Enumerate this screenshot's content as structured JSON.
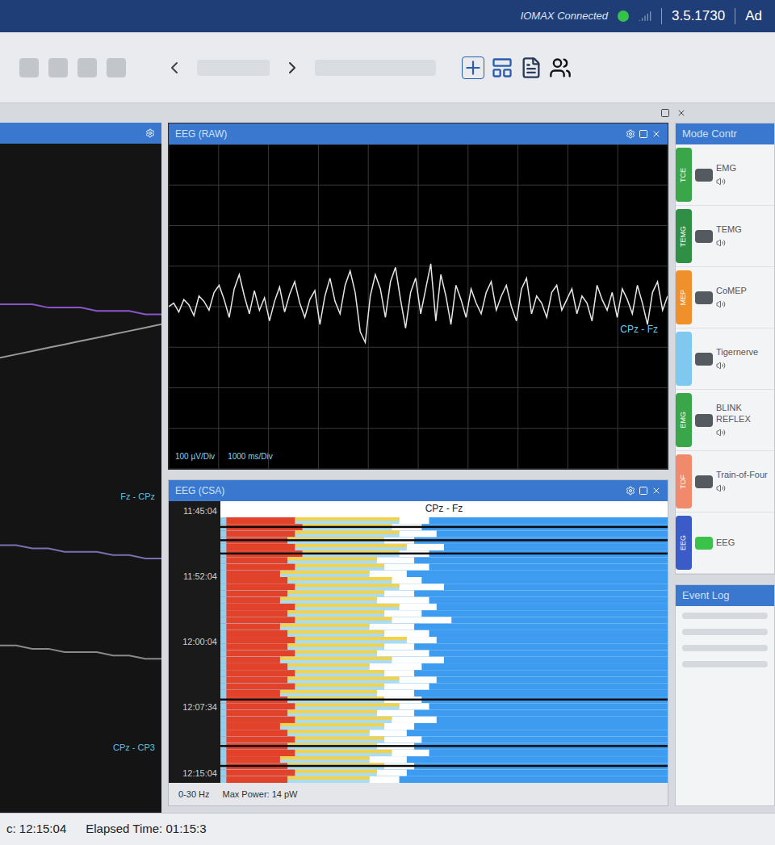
{
  "top_bar": {
    "connection": "IOMAX Connected",
    "connected": true,
    "version": "3.5.1730",
    "user": "Ad"
  },
  "trend_panel": {
    "labels": [
      {
        "text": "Fz - CPz",
        "y": 46
      },
      {
        "text": "CPz - CP3",
        "y": 88
      }
    ],
    "series": [
      {
        "color": "#8a55c9",
        "values": [
          24,
          24,
          24,
          24.5,
          24.5,
          24.5,
          25,
          25,
          25,
          25.5,
          25.5
        ]
      },
      {
        "color": "#9a9a9a",
        "values": [
          32,
          31.5,
          31,
          30.5,
          30,
          29.5,
          29,
          28.5,
          28,
          27.5,
          27
        ]
      },
      {
        "color": "#7a6fb0",
        "values": [
          60,
          60,
          60.5,
          60.5,
          61,
          61,
          61,
          61.5,
          61.5,
          62,
          62
        ]
      },
      {
        "color": "#8a8a8a",
        "values": [
          75,
          75,
          75.5,
          75.5,
          76,
          76,
          76,
          76.5,
          76.5,
          77,
          77
        ]
      }
    ]
  },
  "raw_panel": {
    "title": "EEG (RAW)",
    "channel": "CPz - Fz",
    "scale": [
      "100 µV/Div",
      "1000 ms/Div"
    ],
    "values": [
      0,
      2,
      -3,
      4,
      1,
      -5,
      6,
      3,
      -2,
      8,
      12,
      4,
      -6,
      10,
      18,
      6,
      -4,
      9,
      -2,
      5,
      -8,
      3,
      11,
      -3,
      7,
      14,
      2,
      -6,
      4,
      9,
      -10,
      6,
      16,
      3,
      -4,
      12,
      20,
      8,
      -14,
      -20,
      6,
      18,
      10,
      -6,
      14,
      22,
      4,
      -12,
      8,
      16,
      -4,
      10,
      24,
      -8,
      18,
      6,
      -10,
      12,
      4,
      -6,
      10,
      2,
      -4,
      8,
      14,
      -2,
      6,
      12,
      0,
      -8,
      10,
      16,
      -4,
      6,
      2,
      -6,
      8,
      12,
      -2,
      4,
      10,
      -4,
      6,
      2,
      -8,
      12,
      4,
      -2,
      8,
      -6,
      10,
      4,
      -4,
      12,
      2,
      -10,
      8,
      14,
      -2,
      6
    ]
  },
  "csa_panel": {
    "title": "EEG (CSA)",
    "channel": "CPz - Fz",
    "times": [
      "11:45:04",
      "11:52:04",
      "12:00:04",
      "12:07:34",
      "12:15:04"
    ],
    "range": "0-30 Hz",
    "max_power": "Max Power: 14 pW",
    "rows": [
      {
        "red": 5,
        "yellow": 12,
        "edge": 14,
        "marker": false
      },
      {
        "red": 5.5,
        "yellow": 11.5,
        "edge": 13.5,
        "marker": true
      },
      {
        "red": 5,
        "yellow": 12,
        "edge": 14.5,
        "marker": false
      },
      {
        "red": 4.5,
        "yellow": 11,
        "edge": 13,
        "marker": true
      },
      {
        "red": 5,
        "yellow": 12.5,
        "edge": 15,
        "marker": false
      },
      {
        "red": 5.5,
        "yellow": 12,
        "edge": 14,
        "marker": true
      },
      {
        "red": 4.5,
        "yellow": 10.5,
        "edge": 13,
        "marker": false
      },
      {
        "red": 5,
        "yellow": 11,
        "edge": 14,
        "marker": false
      },
      {
        "red": 4,
        "yellow": 10,
        "edge": 12.5,
        "marker": false
      },
      {
        "red": 4.5,
        "yellow": 11.5,
        "edge": 13.5,
        "marker": false
      },
      {
        "red": 5,
        "yellow": 12,
        "edge": 15,
        "marker": false
      },
      {
        "red": 4.5,
        "yellow": 11,
        "edge": 13,
        "marker": false
      },
      {
        "red": 4,
        "yellow": 10.5,
        "edge": 14,
        "marker": false
      },
      {
        "red": 5,
        "yellow": 12,
        "edge": 14.5,
        "marker": false
      },
      {
        "red": 4.5,
        "yellow": 11,
        "edge": 13.5,
        "marker": false
      },
      {
        "red": 5,
        "yellow": 11.5,
        "edge": 15.5,
        "marker": false
      },
      {
        "red": 4,
        "yellow": 10,
        "edge": 13,
        "marker": false
      },
      {
        "red": 4.5,
        "yellow": 11,
        "edge": 14,
        "marker": false
      },
      {
        "red": 5,
        "yellow": 12.5,
        "edge": 14.5,
        "marker": false
      },
      {
        "red": 4.5,
        "yellow": 11,
        "edge": 13,
        "marker": false
      },
      {
        "red": 5,
        "yellow": 10.5,
        "edge": 14,
        "marker": false
      },
      {
        "red": 4,
        "yellow": 11.5,
        "edge": 15,
        "marker": false
      },
      {
        "red": 4.5,
        "yellow": 10,
        "edge": 13.5,
        "marker": false
      },
      {
        "red": 5,
        "yellow": 11,
        "edge": 13,
        "marker": false
      },
      {
        "red": 4.5,
        "yellow": 12,
        "edge": 14.5,
        "marker": false
      },
      {
        "red": 5,
        "yellow": 11,
        "edge": 14,
        "marker": false
      },
      {
        "red": 4,
        "yellow": 10.5,
        "edge": 13,
        "marker": false
      },
      {
        "red": 4.5,
        "yellow": 11,
        "edge": 13.5,
        "marker": true
      },
      {
        "red": 5,
        "yellow": 12,
        "edge": 14,
        "marker": false
      },
      {
        "red": 4.5,
        "yellow": 10.5,
        "edge": 13,
        "marker": false
      },
      {
        "red": 5,
        "yellow": 11.5,
        "edge": 14.5,
        "marker": false
      },
      {
        "red": 4,
        "yellow": 11,
        "edge": 13,
        "marker": false
      },
      {
        "red": 4.5,
        "yellow": 10,
        "edge": 12.5,
        "marker": false
      },
      {
        "red": 5,
        "yellow": 11,
        "edge": 13.5,
        "marker": false
      },
      {
        "red": 4.5,
        "yellow": 10.5,
        "edge": 13,
        "marker": true
      },
      {
        "red": 5,
        "yellow": 11.5,
        "edge": 14,
        "marker": false
      },
      {
        "red": 4,
        "yellow": 10,
        "edge": 12.5,
        "marker": false
      },
      {
        "red": 4.5,
        "yellow": 11,
        "edge": 13,
        "marker": true
      },
      {
        "red": 5,
        "yellow": 10.5,
        "edge": 12.5,
        "marker": false
      },
      {
        "red": 4.5,
        "yellow": 10,
        "edge": 12,
        "marker": false
      }
    ]
  },
  "mode_control": {
    "title": "Mode Contr",
    "items": [
      {
        "tab": "TCE",
        "label": "EMG",
        "color": "#3aa64a",
        "active": false
      },
      {
        "tab": "TEMG",
        "label": "TEMG",
        "color": "#2f8f45",
        "active": false
      },
      {
        "tab": "MEP",
        "label": "CoMEP",
        "color": "#f0902a",
        "active": false
      },
      {
        "tab": "",
        "label": "Tigernerve",
        "color": "#7fc9f0",
        "active": false
      },
      {
        "tab": "EMG",
        "label": "BLINK REFLEX",
        "color": "#3aa64a",
        "active": false
      },
      {
        "tab": "TOF",
        "label": "Train-of-Four",
        "color": "#f08a6a",
        "active": false
      },
      {
        "tab": "EEG",
        "label": "EEG",
        "color": "#3a5bc8",
        "active": true
      }
    ]
  },
  "event_log": {
    "title": "Event Log"
  },
  "status_bar": {
    "clock": "c: 12:15:04",
    "elapsed": "Elapsed Time: 01:15:3"
  }
}
